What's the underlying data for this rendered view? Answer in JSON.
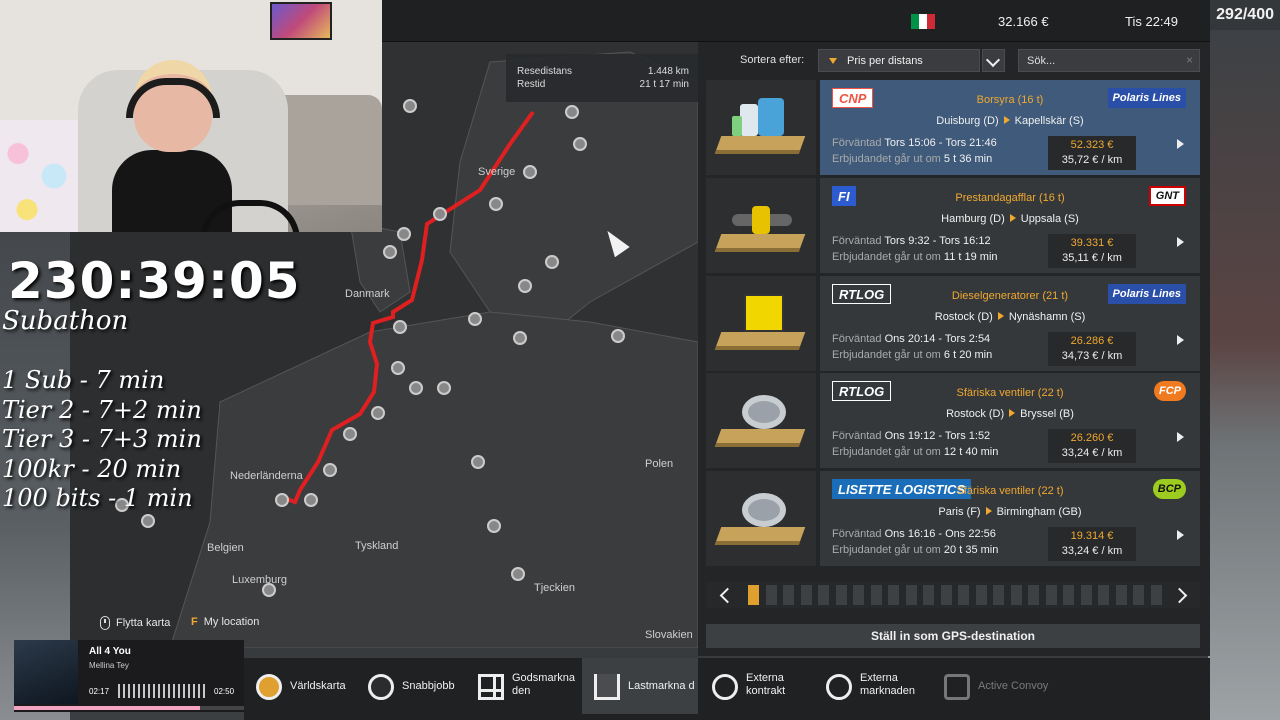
{
  "topbar": {
    "balance": "32.166 €",
    "clock": "Tis 22:49",
    "counter": "292/400",
    "flag_colors": [
      "#009246",
      "#ffffff",
      "#ce2b37"
    ]
  },
  "overlay": {
    "timer": "230:39:05",
    "title": "Subathon",
    "rates": [
      "1 Sub - 7 min",
      "Tier 2 - 7+2 min",
      "Tier 3 - 7+3 min",
      "100kr - 20 min",
      "100 bits - 1 min"
    ]
  },
  "route_info": {
    "distance_label": "Resedistans",
    "distance_value": "1.448 km",
    "time_label": "Restid",
    "time_value": "21 t 17 min"
  },
  "map": {
    "labels": [
      "Sverige",
      "Danmark",
      "Nederländerna",
      "Belgien",
      "Tyskland",
      "Polen",
      "Luxemburg",
      "Tjeckien",
      "Slovakien"
    ],
    "move_hint": "Flytta karta",
    "location_key": "F",
    "location_hint": "My location",
    "route_color": "#e02020"
  },
  "sort": {
    "label": "Sortera efter:",
    "selected": "Pris per distans",
    "search_placeholder": "Sök...",
    "clear_icon": "×"
  },
  "jobs": [
    {
      "company": "CNP",
      "recipient": "Polaris Lines",
      "cargo": "Borsyra (16 t)",
      "from": "Duisburg (D)",
      "to": "Kapellskär (S)",
      "exp_prefix": "Förväntad",
      "expected": "Tors 15:06 - Tors 21:46",
      "offer_prefix": "Erbjudandet går ut om",
      "offer": "5 t 36 min",
      "price": "52.323 €",
      "per_km": "35,72 € / km",
      "selected": true
    },
    {
      "company": "FI",
      "recipient": "GNT",
      "cargo": "Prestandagafflar (16 t)",
      "from": "Hamburg (D)",
      "to": "Uppsala (S)",
      "exp_prefix": "Förväntad",
      "expected": "Tors 9:32 - Tors 16:12",
      "offer_prefix": "Erbjudandet går ut om",
      "offer": "11 t 19 min",
      "price": "39.331 €",
      "per_km": "35,11 € / km",
      "selected": false
    },
    {
      "company": "RTLOG",
      "recipient": "Polaris Lines",
      "cargo": "Dieselgeneratorer (21 t)",
      "from": "Rostock (D)",
      "to": "Nynäshamn (S)",
      "exp_prefix": "Förväntad",
      "expected": "Ons 20:14 - Tors 2:54",
      "offer_prefix": "Erbjudandet går ut om",
      "offer": "6 t 20 min",
      "price": "26.286 €",
      "per_km": "34,73 € / km",
      "selected": false
    },
    {
      "company": "RTLOG",
      "recipient": "FCP",
      "cargo": "Sfäriska ventiler (22 t)",
      "from": "Rostock (D)",
      "to": "Bryssel (B)",
      "exp_prefix": "Förväntad",
      "expected": "Ons 19:12 - Tors 1:52",
      "offer_prefix": "Erbjudandet går ut om",
      "offer": "12 t 40 min",
      "price": "26.260 €",
      "per_km": "33,24 € / km",
      "selected": false
    },
    {
      "company": "LISETTE LOGISTICS",
      "recipient": "BCP",
      "cargo": "Sfäriska ventiler (22 t)",
      "from": "Paris (F)",
      "to": "Birmingham (GB)",
      "exp_prefix": "Förväntad",
      "expected": "Ons 16:16 - Ons 22:56",
      "offer_prefix": "Erbjudandet går ut om",
      "offer": "20 t 35 min",
      "price": "19.314 €",
      "per_km": "33,24 € / km",
      "selected": false
    }
  ],
  "pager": {
    "pages": 24,
    "current": 1
  },
  "gps_button": "Ställ in som GPS-destination",
  "nav": [
    {
      "label": "Världskarta",
      "icon": "world-map-icon"
    },
    {
      "label": "Snabbjobb",
      "icon": "stopwatch-icon"
    },
    {
      "label": "Godsmarkna den",
      "icon": "cargo-market-icon"
    },
    {
      "label": "Lastmarkna d",
      "icon": "freight-market-icon",
      "active": true
    },
    {
      "label": "Externa kontrakt",
      "icon": "globe-contract-icon"
    },
    {
      "label": "Externa marknaden",
      "icon": "globe-market-icon"
    },
    {
      "label": "Active Convoy",
      "icon": "convoy-icon",
      "disabled": true
    }
  ],
  "music": {
    "title": "All 4 You",
    "artist": "Mellina Tey",
    "elapsed": "02:17",
    "total": "02:50",
    "progress": 0.81
  }
}
